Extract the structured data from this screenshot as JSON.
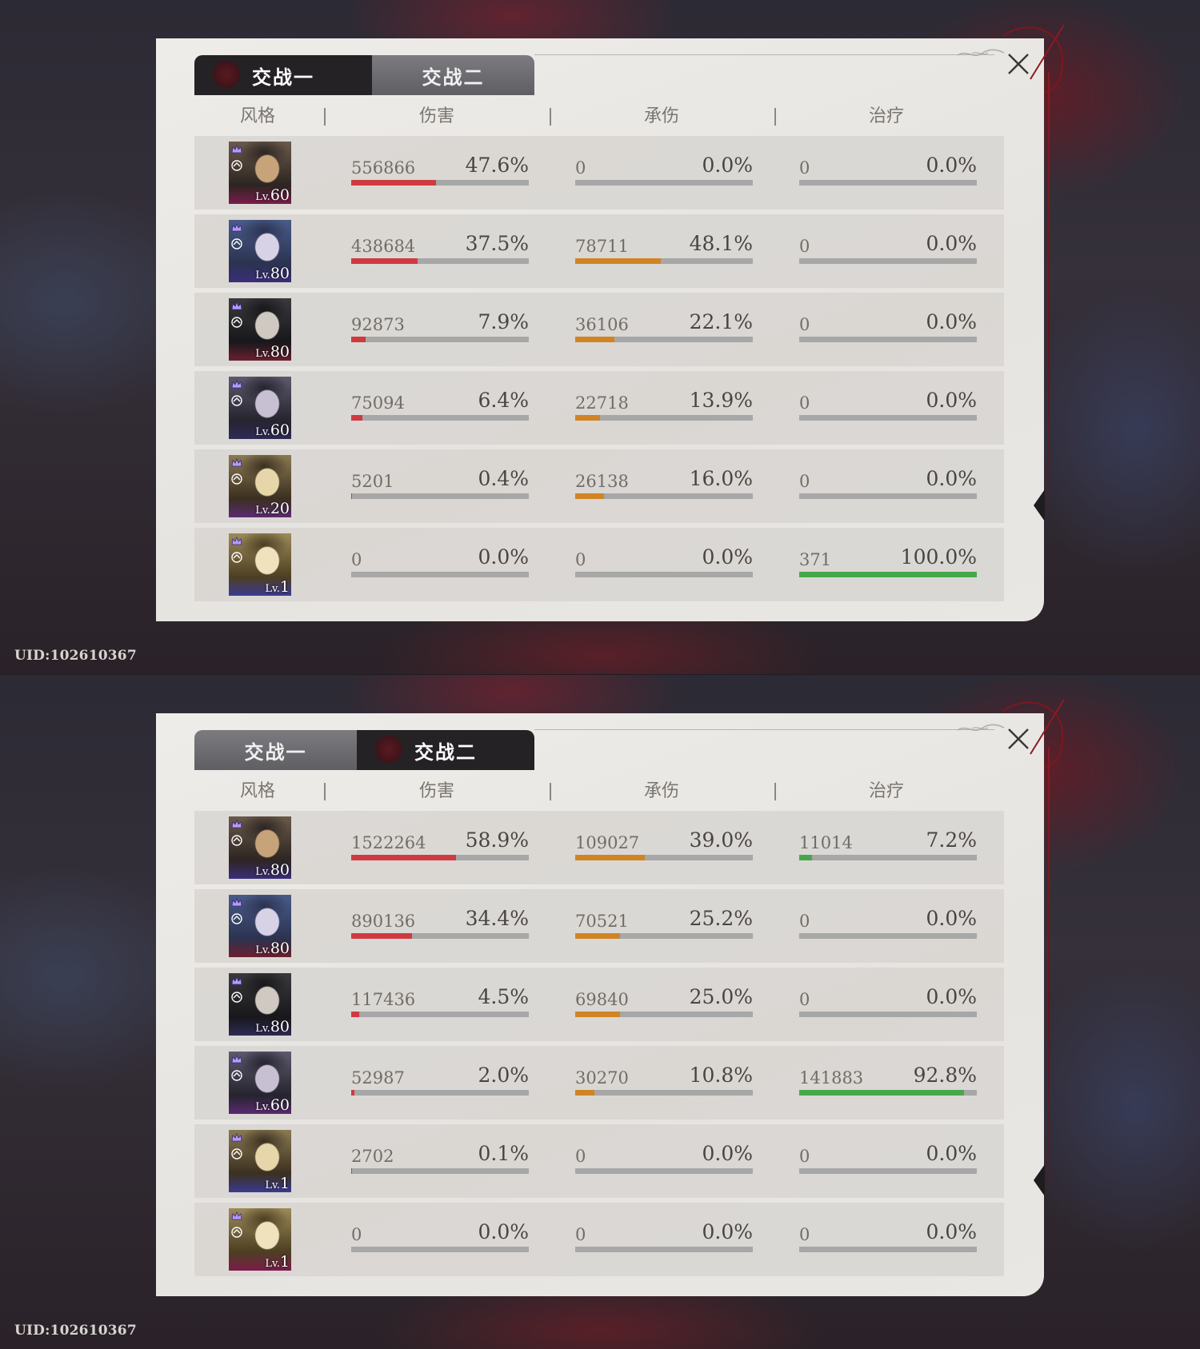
{
  "uid_label": "UID:102610367",
  "colors": {
    "damage": "#cf3a41",
    "tanked": "#d08424",
    "healing": "#46a84a",
    "track": "#a7a7a7",
    "tab_active": "#242224",
    "tab_inactive": "#6b6b6f"
  },
  "icons": {
    "close": "close-icon",
    "rank_badges": [
      "crown-icon",
      "sword-icon",
      "shield-icon",
      "leaf-icon",
      "wing-icon",
      "feather-icon"
    ]
  },
  "headers": {
    "style": "风格",
    "damage": "伤害",
    "tanked": "承伤",
    "healing": "治疗"
  },
  "battles": [
    {
      "tabs": {
        "first": "交战一",
        "second": "交战二"
      },
      "active_tab": "first",
      "rows": [
        {
          "lv_prefix": "Lv.",
          "lv": "60",
          "dmg": "556866",
          "dmg_pct": "47.6%",
          "dmg_frac": 0.476,
          "tank": "0",
          "tank_pct": "0.0%",
          "tank_frac": 0,
          "heal": "0",
          "heal_pct": "0.0%",
          "heal_frac": 0
        },
        {
          "lv_prefix": "Lv.",
          "lv": "80",
          "dmg": "438684",
          "dmg_pct": "37.5%",
          "dmg_frac": 0.375,
          "tank": "78711",
          "tank_pct": "48.1%",
          "tank_frac": 0.481,
          "heal": "0",
          "heal_pct": "0.0%",
          "heal_frac": 0
        },
        {
          "lv_prefix": "Lv.",
          "lv": "80",
          "dmg": "92873",
          "dmg_pct": "7.9%",
          "dmg_frac": 0.079,
          "tank": "36106",
          "tank_pct": "22.1%",
          "tank_frac": 0.221,
          "heal": "0",
          "heal_pct": "0.0%",
          "heal_frac": 0
        },
        {
          "lv_prefix": "Lv.",
          "lv": "60",
          "dmg": "75094",
          "dmg_pct": "6.4%",
          "dmg_frac": 0.064,
          "tank": "22718",
          "tank_pct": "13.9%",
          "tank_frac": 0.139,
          "heal": "0",
          "heal_pct": "0.0%",
          "heal_frac": 0
        },
        {
          "lv_prefix": "Lv.",
          "lv": "20",
          "dmg": "5201",
          "dmg_pct": "0.4%",
          "dmg_frac": 0.004,
          "tank": "26138",
          "tank_pct": "16.0%",
          "tank_frac": 0.16,
          "heal": "0",
          "heal_pct": "0.0%",
          "heal_frac": 0
        },
        {
          "lv_prefix": "Lv.",
          "lv": "1",
          "dmg": "0",
          "dmg_pct": "0.0%",
          "dmg_frac": 0,
          "tank": "0",
          "tank_pct": "0.0%",
          "tank_frac": 0,
          "heal": "371",
          "heal_pct": "100.0%",
          "heal_frac": 1.0
        }
      ]
    },
    {
      "tabs": {
        "first": "交战一",
        "second": "交战二"
      },
      "active_tab": "second",
      "rows": [
        {
          "lv_prefix": "Lv.",
          "lv": "80",
          "dmg": "1522264",
          "dmg_pct": "58.9%",
          "dmg_frac": 0.589,
          "tank": "109027",
          "tank_pct": "39.0%",
          "tank_frac": 0.39,
          "heal": "11014",
          "heal_pct": "7.2%",
          "heal_frac": 0.072
        },
        {
          "lv_prefix": "Lv.",
          "lv": "80",
          "dmg": "890136",
          "dmg_pct": "34.4%",
          "dmg_frac": 0.344,
          "tank": "70521",
          "tank_pct": "25.2%",
          "tank_frac": 0.252,
          "heal": "0",
          "heal_pct": "0.0%",
          "heal_frac": 0
        },
        {
          "lv_prefix": "Lv.",
          "lv": "80",
          "dmg": "117436",
          "dmg_pct": "4.5%",
          "dmg_frac": 0.045,
          "tank": "69840",
          "tank_pct": "25.0%",
          "tank_frac": 0.25,
          "heal": "0",
          "heal_pct": "0.0%",
          "heal_frac": 0
        },
        {
          "lv_prefix": "Lv.",
          "lv": "60",
          "dmg": "52987",
          "dmg_pct": "2.0%",
          "dmg_frac": 0.02,
          "tank": "30270",
          "tank_pct": "10.8%",
          "tank_frac": 0.108,
          "heal": "141883",
          "heal_pct": "92.8%",
          "heal_frac": 0.928
        },
        {
          "lv_prefix": "Lv.",
          "lv": "1",
          "dmg": "2702",
          "dmg_pct": "0.1%",
          "dmg_frac": 0.001,
          "tank": "0",
          "tank_pct": "0.0%",
          "tank_frac": 0,
          "heal": "0",
          "heal_pct": "0.0%",
          "heal_frac": 0
        },
        {
          "lv_prefix": "Lv.",
          "lv": "1",
          "dmg": "0",
          "dmg_pct": "0.0%",
          "dmg_frac": 0,
          "tank": "0",
          "tank_pct": "0.0%",
          "tank_frac": 0,
          "heal": "0",
          "heal_pct": "0.0%",
          "heal_frac": 0
        }
      ]
    }
  ]
}
